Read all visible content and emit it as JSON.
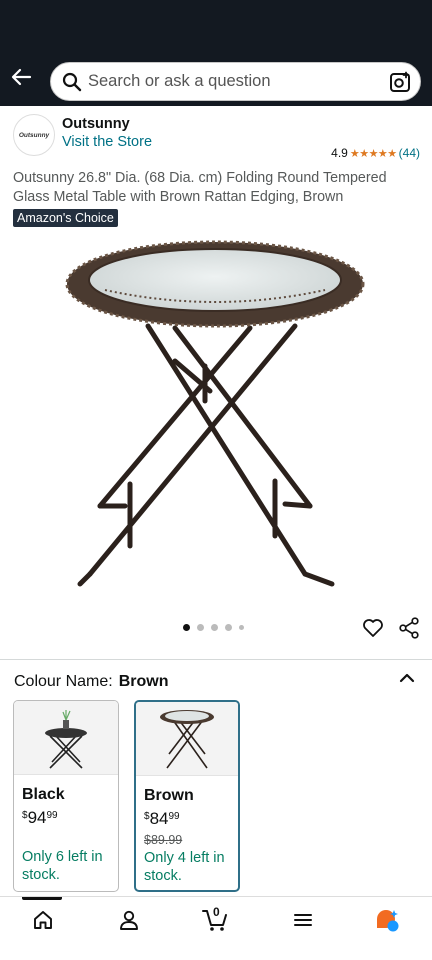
{
  "header": {
    "search_placeholder": "Search or ask a question"
  },
  "store": {
    "logo_text": "Outsunny",
    "name": "Outsunny",
    "link": "Visit the Store",
    "rating": "4.9",
    "stars": "★★★★★",
    "review_count": "(44)"
  },
  "product": {
    "title": "Outsunny 26.8\" Dia. (68 Dia. cm) Folding Round Tempered Glass Metal Table with Brown Rattan Edging, Brown",
    "badge": "Amazon's Choice",
    "image_icon": "round-folding-table-image",
    "image_count": 5,
    "active_image_index": 0
  },
  "variation": {
    "label": "Colour Name:",
    "selected": "Brown",
    "options": [
      {
        "name": "Black",
        "price_symbol": "$",
        "price_whole": "94",
        "price_fraction": "99",
        "list_price": "",
        "stock": "Only 6 left in stock."
      },
      {
        "name": "Brown",
        "price_symbol": "$",
        "price_whole": "84",
        "price_fraction": "99",
        "list_price": "$89.99",
        "stock": "Only 4 left in stock."
      }
    ]
  },
  "bottom_nav": {
    "cart_count": "0",
    "items": [
      "home-icon",
      "account-icon",
      "cart-icon",
      "menu-icon",
      "rufus-icon"
    ]
  },
  "colors": {
    "header_bg": "#131921",
    "link": "#007185",
    "star": "#de7921",
    "stock_green": "#067d62",
    "selected_border": "#2f6f88"
  }
}
